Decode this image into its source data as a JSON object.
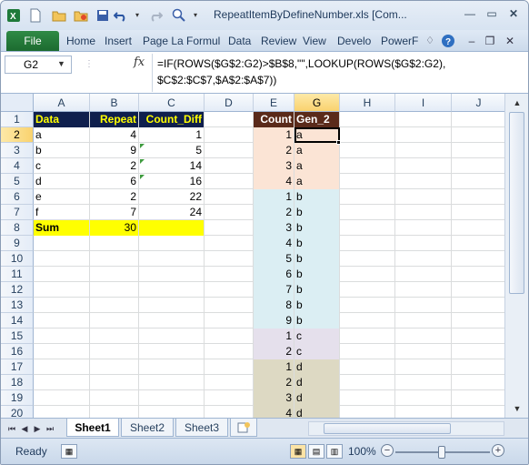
{
  "window": {
    "title": "RepeatItemByDefineNumber.xls  [Com..."
  },
  "ribbon": {
    "file_label": "File",
    "tabs": [
      "Home",
      "Insert",
      "Page La",
      "Formul",
      "Data",
      "Review",
      "View",
      "Develo",
      "PowerF"
    ]
  },
  "formula_bar": {
    "name_box": "G2",
    "fx_label": "fx",
    "formula_line1": "=IF(ROWS($G$2:G2)>$B$8,\"\",LOOKUP(ROWS($G$2:G2),",
    "formula_line2": "$C$2:$C$7,$A$2:$A$7))"
  },
  "grid": {
    "columns": [
      "A",
      "B",
      "C",
      "D",
      "E",
      "G",
      "H",
      "I",
      "J"
    ],
    "selected_column": "G",
    "rows": [
      "1",
      "2",
      "3",
      "4",
      "5",
      "6",
      "7",
      "8",
      "9",
      "10",
      "11",
      "12",
      "13",
      "14",
      "15",
      "16",
      "17",
      "18",
      "19",
      "20"
    ],
    "selected_row": "2",
    "headers": {
      "A1": "Data",
      "B1": "Repeat",
      "C1": "Count_Diff",
      "E1": "Count",
      "G1": "Gen_2"
    },
    "table_rows": [
      {
        "data": "a",
        "repeat": "4",
        "count_diff": "1"
      },
      {
        "data": "b",
        "repeat": "9",
        "count_diff": "5"
      },
      {
        "data": "c",
        "repeat": "2",
        "count_diff": "14"
      },
      {
        "data": "d",
        "repeat": "6",
        "count_diff": "16"
      },
      {
        "data": "e",
        "repeat": "2",
        "count_diff": "22"
      },
      {
        "data": "f",
        "repeat": "7",
        "count_diff": "24"
      }
    ],
    "sum_label": "Sum",
    "sum_value": "30",
    "gen_rows": [
      {
        "count": "1",
        "gen": "a"
      },
      {
        "count": "2",
        "gen": "a"
      },
      {
        "count": "3",
        "gen": "a"
      },
      {
        "count": "4",
        "gen": "a"
      },
      {
        "count": "1",
        "gen": "b"
      },
      {
        "count": "2",
        "gen": "b"
      },
      {
        "count": "3",
        "gen": "b"
      },
      {
        "count": "4",
        "gen": "b"
      },
      {
        "count": "5",
        "gen": "b"
      },
      {
        "count": "6",
        "gen": "b"
      },
      {
        "count": "7",
        "gen": "b"
      },
      {
        "count": "8",
        "gen": "b"
      },
      {
        "count": "9",
        "gen": "b"
      },
      {
        "count": "1",
        "gen": "c"
      },
      {
        "count": "2",
        "gen": "c"
      },
      {
        "count": "1",
        "gen": "d"
      },
      {
        "count": "2",
        "gen": "d"
      },
      {
        "count": "3",
        "gen": "d"
      },
      {
        "count": "4",
        "gen": "d"
      }
    ],
    "colors": {
      "header_fill": "#0f1f4d",
      "header_text": "#ffff00",
      "sum_fill": "#ffff00",
      "count_header_fill": "#5a2a1a",
      "a_fill": "#fbe4d5",
      "b_fill": "#dbeef3",
      "c_fill": "#e5e0ec",
      "d_fill": "#ddd9c3",
      "gen_header_fill": "#f2dcdb"
    }
  },
  "sheets": {
    "tabs": [
      "Sheet1",
      "Sheet2",
      "Sheet3"
    ],
    "active": "Sheet1"
  },
  "status": {
    "ready": "Ready",
    "zoom": "100%"
  }
}
